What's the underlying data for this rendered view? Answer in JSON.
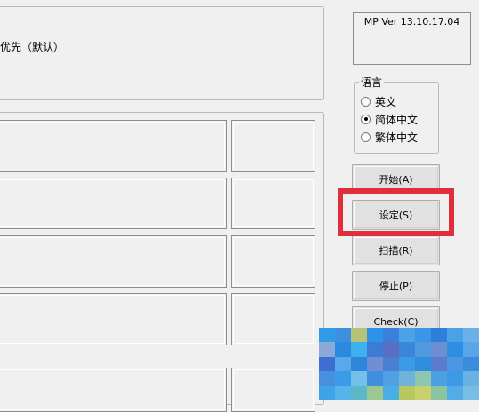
{
  "top_panel": {
    "text": "优先（默认）"
  },
  "version": {
    "text": "MP Ver 13.10.17.04"
  },
  "language": {
    "legend": "语言",
    "options": [
      {
        "label": "英文",
        "selected": false
      },
      {
        "label": "简体中文",
        "selected": true
      },
      {
        "label": "繁体中文",
        "selected": false
      }
    ]
  },
  "buttons": {
    "start": "开始(A)",
    "settings": "设定(S)",
    "scan": "扫描(R)",
    "stop": "停止(P)",
    "check": "Check(C)"
  },
  "colors": {
    "highlight": "#e02f3b",
    "mosaic": [
      "#2f9be6",
      "#3f8fe0",
      "#b6c277",
      "#2e92e8",
      "#3a7fd8",
      "#49a3e6",
      "#3d95e8",
      "#2c7fda",
      "#4aa2e6",
      "#6ab1e8",
      "#8aa9d8",
      "#2a8ae0",
      "#3fb0ee",
      "#3d7cd6",
      "#5a6fc4",
      "#3a86d8",
      "#4e9be0",
      "#6b8fd0",
      "#2d8ee4",
      "#58a6e8",
      "#3b6fd0",
      "#5aa8ec",
      "#2e85dc",
      "#6f8ed6",
      "#4b7fd2",
      "#3c9ae6",
      "#2f8de0",
      "#5a7ccc",
      "#4d96e2",
      "#3a8cdc",
      "#4a8ee0",
      "#3a9be8",
      "#74c0ea",
      "#3e8fe0",
      "#52a0e4",
      "#6fb4d8",
      "#8ec6b0",
      "#4aa0e0",
      "#3b9be6",
      "#69b3e2",
      "#3ea4e8",
      "#56b4ea",
      "#5cb8c8",
      "#9cc890",
      "#4aaee6",
      "#b8c860",
      "#c8d070",
      "#8cc4a0",
      "#54ace6",
      "#77bde4"
    ]
  }
}
